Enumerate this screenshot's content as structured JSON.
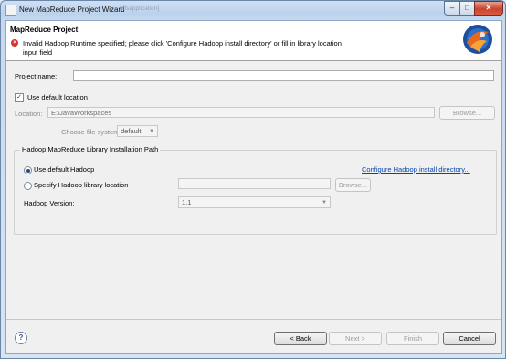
{
  "window": {
    "title": "New MapReduce Project Wizard",
    "blurred_title": "[dfsapplication]",
    "controls": {
      "minimize": "–",
      "maximize": "□",
      "close": "✕"
    }
  },
  "banner": {
    "title": "MapReduce Project",
    "message": "Invalid Hadoop Runtime specified; please click 'Configure Hadoop install directory' or fill in library location input field",
    "error_icon_glyph": "×"
  },
  "project": {
    "name_label": "Project name:",
    "name_value": ""
  },
  "location": {
    "use_default_label": "Use default location",
    "use_default_checked": true,
    "location_label": "Location:",
    "location_value": "E:\\JavaWorkspaces",
    "browse_label": "Browse...",
    "filesystem_label": "Choose file system:",
    "filesystem_value": "default"
  },
  "hadoop": {
    "group_title": "Hadoop MapReduce Library Installation Path",
    "use_default_label": "Use default Hadoop",
    "configure_link": "Configure Hadoop install directory...",
    "specify_label": "Specify Hadoop library location",
    "specify_value": "",
    "browse_label": "Browse...",
    "version_label": "Hadoop Version:",
    "version_value": "1.1"
  },
  "footer": {
    "help_glyph": "?",
    "back_label": "< Back",
    "next_label": "Next >",
    "finish_label": "Finish",
    "cancel_label": "Cancel"
  },
  "colors": {
    "error": "#d8332a",
    "link": "#0645ad",
    "window_frame": "#bcd2ec"
  }
}
